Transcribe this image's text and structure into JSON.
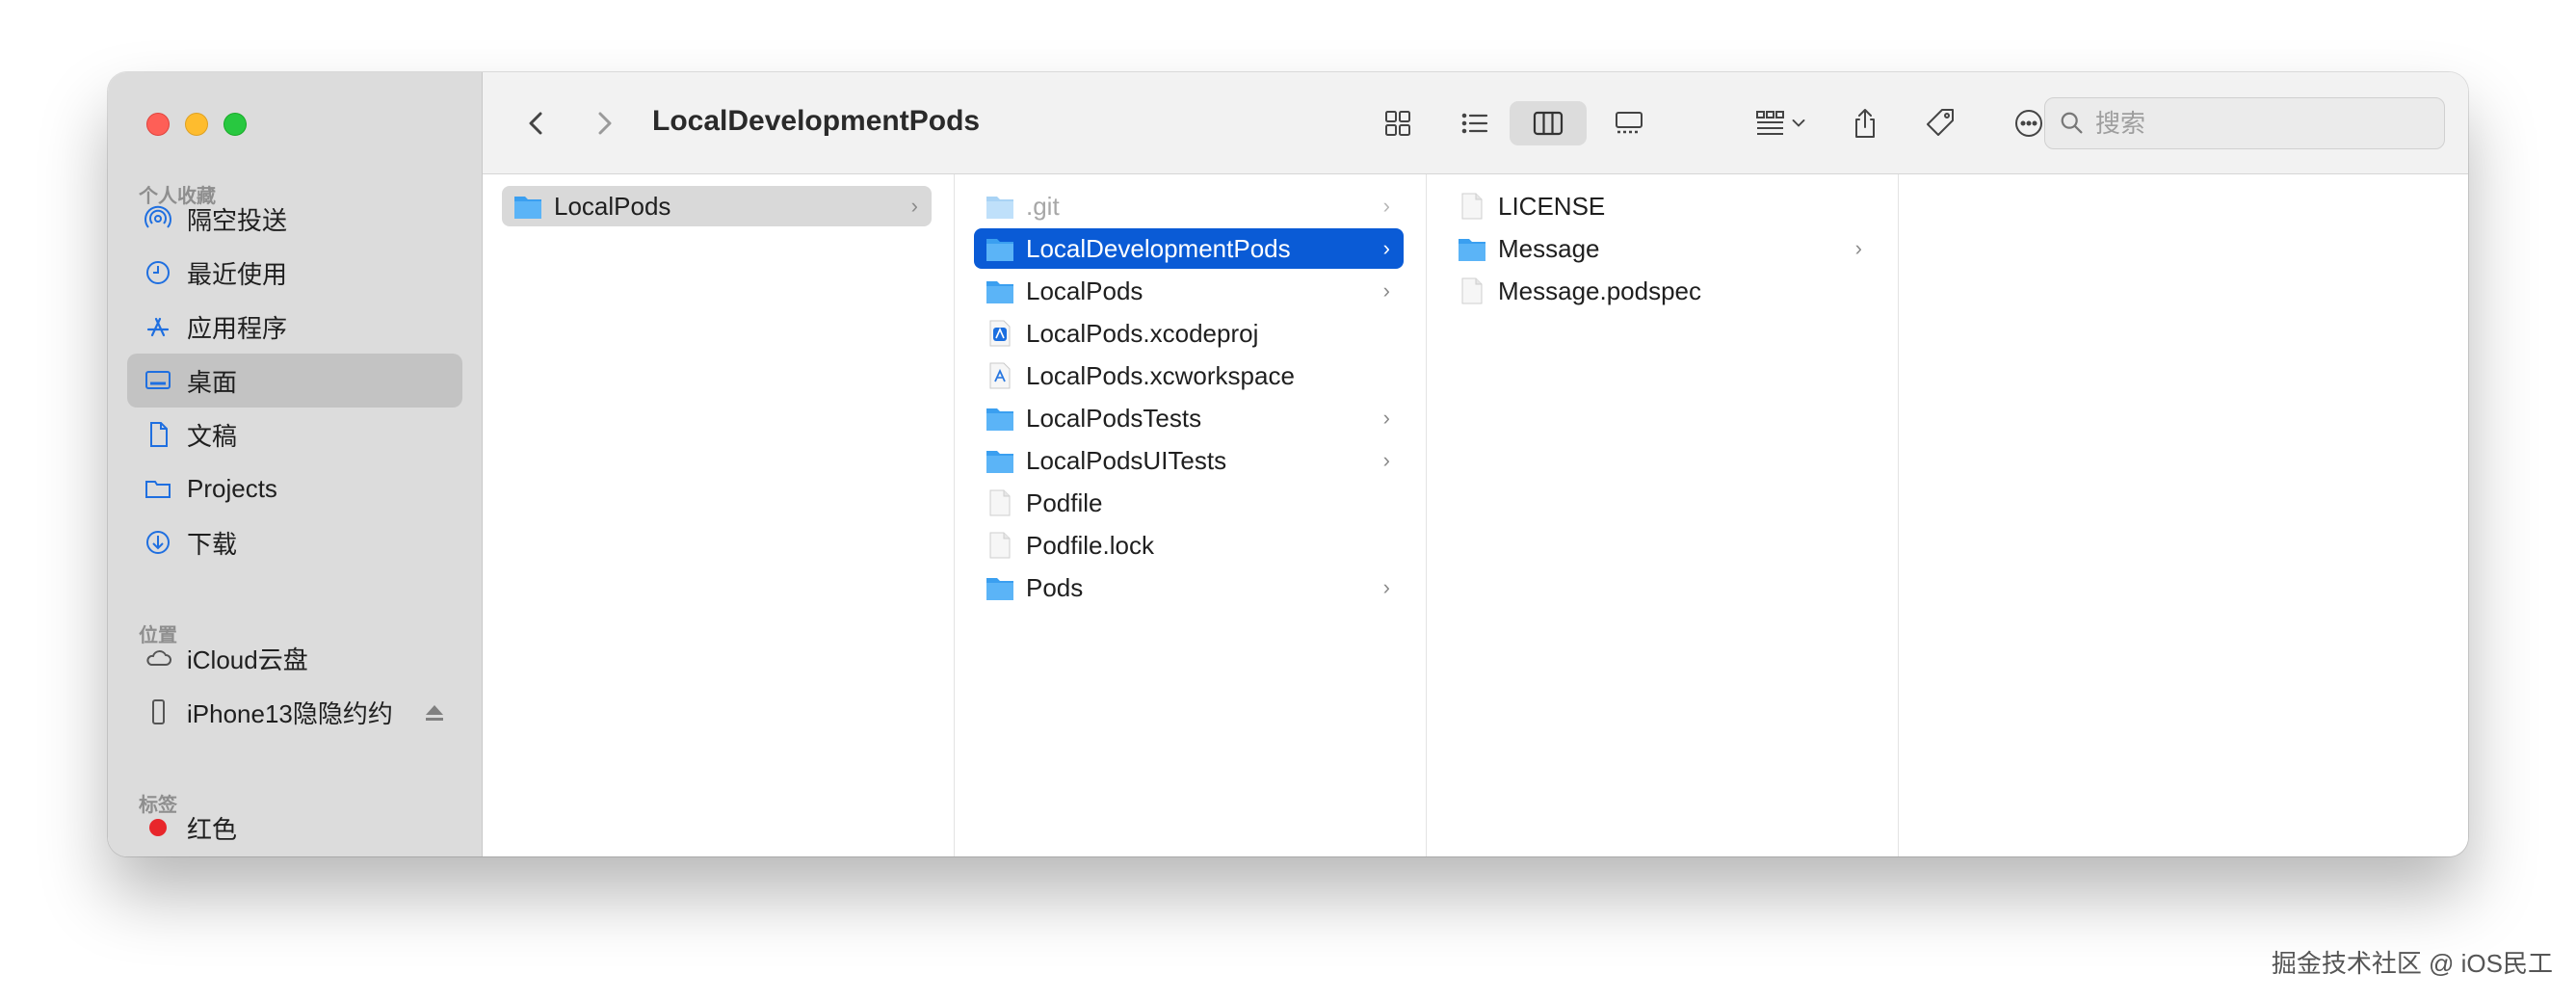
{
  "window_title": "LocalDevelopmentPods",
  "sidebar": {
    "favorites_title": "个人收藏",
    "favorites": [
      {
        "label": "隔空投送",
        "icon": "airdrop-icon"
      },
      {
        "label": "最近使用",
        "icon": "clock-icon"
      },
      {
        "label": "应用程序",
        "icon": "applications-icon"
      },
      {
        "label": "桌面",
        "icon": "desktop-icon"
      },
      {
        "label": "文稿",
        "icon": "document-icon"
      },
      {
        "label": "Projects",
        "icon": "folder-icon"
      },
      {
        "label": "下载",
        "icon": "download-icon"
      }
    ],
    "locations_title": "位置",
    "locations": [
      {
        "label": "iCloud云盘",
        "icon": "cloud-icon"
      },
      {
        "label": "iPhone13隐隐约约",
        "icon": "iphone-icon"
      }
    ],
    "tags_title": "标签",
    "tags": [
      {
        "label": "红色",
        "color": "#e8262b"
      }
    ]
  },
  "search": {
    "placeholder": "搜索"
  },
  "columns": {
    "col1": [
      {
        "name": "LocalPods",
        "type": "folder",
        "has_children": true
      }
    ],
    "col2": [
      {
        "name": ".git",
        "type": "folder",
        "has_children": true
      },
      {
        "name": "LocalDevelopmentPods",
        "type": "folder",
        "has_children": true
      },
      {
        "name": "LocalPods",
        "type": "folder",
        "has_children": true
      },
      {
        "name": "LocalPods.xcodeproj",
        "type": "xcodeproj",
        "has_children": false
      },
      {
        "name": "LocalPods.xcworkspace",
        "type": "xcworkspace",
        "has_children": false
      },
      {
        "name": "LocalPodsTests",
        "type": "folder",
        "has_children": true
      },
      {
        "name": "LocalPodsUITests",
        "type": "folder",
        "has_children": true
      },
      {
        "name": "Podfile",
        "type": "file",
        "has_children": false
      },
      {
        "name": "Podfile.lock",
        "type": "file",
        "has_children": false
      },
      {
        "name": "Pods",
        "type": "folder",
        "has_children": true
      }
    ],
    "col3": [
      {
        "name": "LICENSE",
        "type": "file",
        "has_children": false
      },
      {
        "name": "Message",
        "type": "folder",
        "has_children": true
      },
      {
        "name": "Message.podspec",
        "type": "file",
        "has_children": false
      }
    ]
  },
  "chevron": "›",
  "watermark": "掘金技术社区 @ iOS民工",
  "colors": {
    "selection_blue": "#0a5bd6",
    "folder_blue": "#3a9ff0",
    "sidebar_accent": "#1f6fe0"
  }
}
